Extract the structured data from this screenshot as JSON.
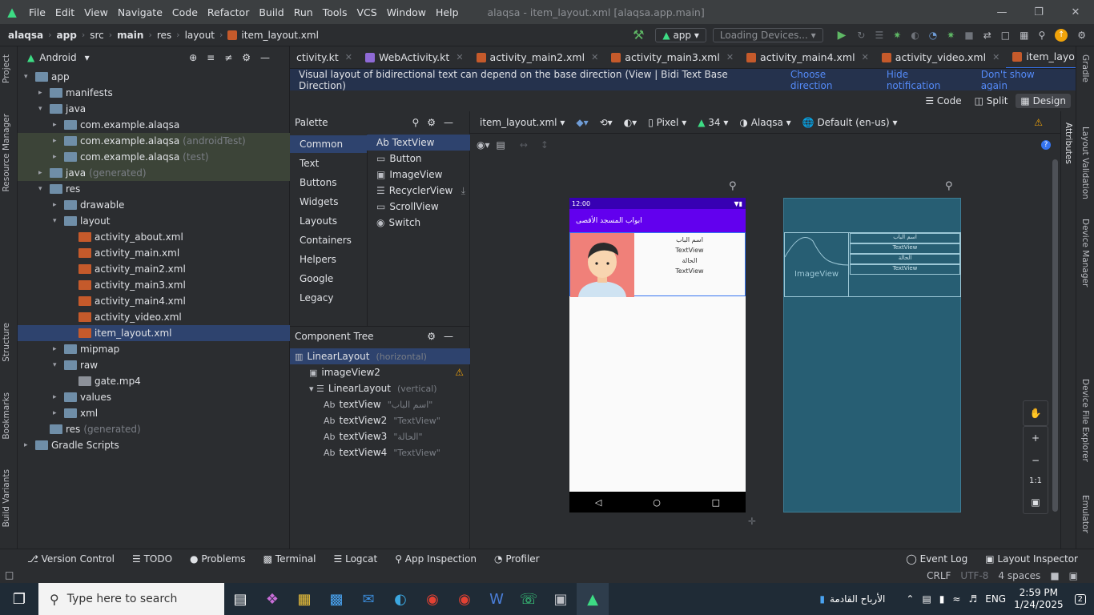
{
  "titlebar": {
    "menus": [
      "File",
      "Edit",
      "View",
      "Navigate",
      "Code",
      "Refactor",
      "Build",
      "Run",
      "Tools",
      "VCS",
      "Window",
      "Help"
    ],
    "title": "alaqsa - item_layout.xml [alaqsa.app.main]"
  },
  "breadcrumb": [
    "alaqsa",
    "app",
    "src",
    "main",
    "res",
    "layout",
    "item_layout.xml"
  ],
  "run": {
    "config": "app",
    "device": "Loading Devices..."
  },
  "project": {
    "view": "Android",
    "tree": [
      {
        "label": "app",
        "extra": "",
        "indent": 0,
        "type": "folder",
        "open": true
      },
      {
        "label": "manifests",
        "extra": "",
        "indent": 1,
        "type": "folder",
        "open": false
      },
      {
        "label": "java",
        "extra": "",
        "indent": 1,
        "type": "folder",
        "open": true
      },
      {
        "label": "com.example.alaqsa",
        "extra": "",
        "indent": 2,
        "type": "folder",
        "open": false
      },
      {
        "label": "com.example.alaqsa",
        "extra": "(androidTest)",
        "indent": 2,
        "type": "folder",
        "open": false
      },
      {
        "label": "com.example.alaqsa",
        "extra": "(test)",
        "indent": 2,
        "type": "folder",
        "open": false
      },
      {
        "label": "java",
        "extra": "(generated)",
        "indent": 1,
        "type": "folder",
        "open": false
      },
      {
        "label": "res",
        "extra": "",
        "indent": 1,
        "type": "folder",
        "open": true
      },
      {
        "label": "drawable",
        "extra": "",
        "indent": 2,
        "type": "folder",
        "open": false
      },
      {
        "label": "layout",
        "extra": "",
        "indent": 2,
        "type": "folder",
        "open": true
      },
      {
        "label": "activity_about.xml",
        "extra": "",
        "indent": 3,
        "type": "xml"
      },
      {
        "label": "activity_main.xml",
        "extra": "",
        "indent": 3,
        "type": "xml"
      },
      {
        "label": "activity_main2.xml",
        "extra": "",
        "indent": 3,
        "type": "xml"
      },
      {
        "label": "activity_main3.xml",
        "extra": "",
        "indent": 3,
        "type": "xml"
      },
      {
        "label": "activity_main4.xml",
        "extra": "",
        "indent": 3,
        "type": "xml"
      },
      {
        "label": "activity_video.xml",
        "extra": "",
        "indent": 3,
        "type": "xml"
      },
      {
        "label": "item_layout.xml",
        "extra": "",
        "indent": 3,
        "type": "xml",
        "selected": true
      },
      {
        "label": "mipmap",
        "extra": "",
        "indent": 2,
        "type": "folder",
        "open": false
      },
      {
        "label": "raw",
        "extra": "",
        "indent": 2,
        "type": "folder",
        "open": true
      },
      {
        "label": "gate.mp4",
        "extra": "",
        "indent": 3,
        "type": "file"
      },
      {
        "label": "values",
        "extra": "",
        "indent": 2,
        "type": "folder",
        "open": false
      },
      {
        "label": "xml",
        "extra": "",
        "indent": 2,
        "type": "folder",
        "open": false
      },
      {
        "label": "res",
        "extra": "(generated)",
        "indent": 1,
        "type": "folder"
      },
      {
        "label": "Gradle Scripts",
        "extra": "",
        "indent": 0,
        "type": "gradle",
        "open": false
      }
    ]
  },
  "tabs": [
    {
      "label": "ctivity.kt",
      "color": "#8f6ad6"
    },
    {
      "label": "WebActivity.kt",
      "color": "#8f6ad6"
    },
    {
      "label": "activity_main2.xml",
      "color": "#c55a2b"
    },
    {
      "label": "activity_main3.xml",
      "color": "#c55a2b"
    },
    {
      "label": "activity_main4.xml",
      "color": "#c55a2b"
    },
    {
      "label": "activity_video.xml",
      "color": "#c55a2b"
    },
    {
      "label": "item_layout.xml",
      "color": "#c55a2b",
      "active": true
    }
  ],
  "notification": {
    "text": "Visual layout of bidirectional text can depend on the base direction (View | Bidi Text Base Direction)",
    "links": [
      "Choose direction",
      "Hide notification",
      "Don't show again"
    ]
  },
  "modes": [
    "Code",
    "Split",
    "Design"
  ],
  "palette": {
    "title": "Palette",
    "categories": [
      "Common",
      "Text",
      "Buttons",
      "Widgets",
      "Layouts",
      "Containers",
      "Helpers",
      "Google",
      "Legacy"
    ],
    "items": [
      "Ab TextView",
      "Button",
      "ImageView",
      "RecyclerView",
      "ScrollView",
      "Switch"
    ]
  },
  "component_tree": {
    "title": "Component Tree",
    "rows": [
      {
        "label": "LinearLayout",
        "sub": "(horizontal)",
        "indent": 0
      },
      {
        "label": "imageView2",
        "sub": "",
        "indent": 1
      },
      {
        "label": "LinearLayout",
        "sub": "(vertical)",
        "indent": 1
      },
      {
        "label": "textView",
        "sub": "\"اسم الباب\"",
        "indent": 2
      },
      {
        "label": "textView2",
        "sub": "\"TextView\"",
        "indent": 2
      },
      {
        "label": "textView3",
        "sub": "\"الحالة\"",
        "indent": 2
      },
      {
        "label": "textView4",
        "sub": "\"TextView\"",
        "indent": 2
      }
    ]
  },
  "design_toolbar": {
    "file": "item_layout.xml",
    "device": "Pixel",
    "api": "34",
    "theme": "Alaqsa",
    "locale": "Default (en-us)"
  },
  "phone": {
    "time": "12:00",
    "app_title": "ابواب المسجد الأقصى",
    "texts": [
      "اسم الباب",
      "TextView",
      "الحالة",
      "TextView"
    ]
  },
  "blueprint": {
    "image_label": "ImageView",
    "texts": [
      "اسم الباب",
      "TextView",
      "الحالة",
      "TextView"
    ]
  },
  "right_tabs": [
    "Gradle",
    "Layout Validation",
    "Device Manager",
    "Device File Explorer",
    "Emulator"
  ],
  "attr_tab": "Attributes",
  "left_tabs": [
    "Project",
    "Resource Manager",
    "Structure",
    "Bookmarks",
    "Build Variants"
  ],
  "zoom": [
    "+",
    "−",
    "1:1"
  ],
  "bottom_tools": [
    "Version Control",
    "TODO",
    "Problems",
    "Terminal",
    "Logcat",
    "App Inspection",
    "Profiler"
  ],
  "bottom_right_tools": [
    "Event Log",
    "Layout Inspector"
  ],
  "status": [
    "CRLF",
    "UTF-8",
    "4 spaces"
  ],
  "taskbar": {
    "search_placeholder": "Type here to search",
    "weather_text": "الأرباح القادمة",
    "lang": "ENG",
    "time": "2:59 PM",
    "date": "1/24/2025",
    "notif_count": "2"
  }
}
